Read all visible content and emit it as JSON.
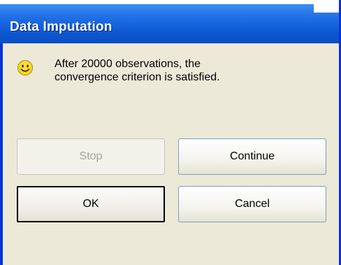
{
  "window": {
    "title": "Data Imputation"
  },
  "dialog": {
    "icon": "smiley-icon",
    "message_line1": "After 20000 observations, the",
    "message_line2": "convergence criterion is satisfied."
  },
  "buttons": {
    "stop": "Stop",
    "continue": "Continue",
    "ok": "OK",
    "cancel": "Cancel"
  },
  "colors": {
    "titlebar": "#0d58d2",
    "dialog_bg": "#ece9d8"
  }
}
